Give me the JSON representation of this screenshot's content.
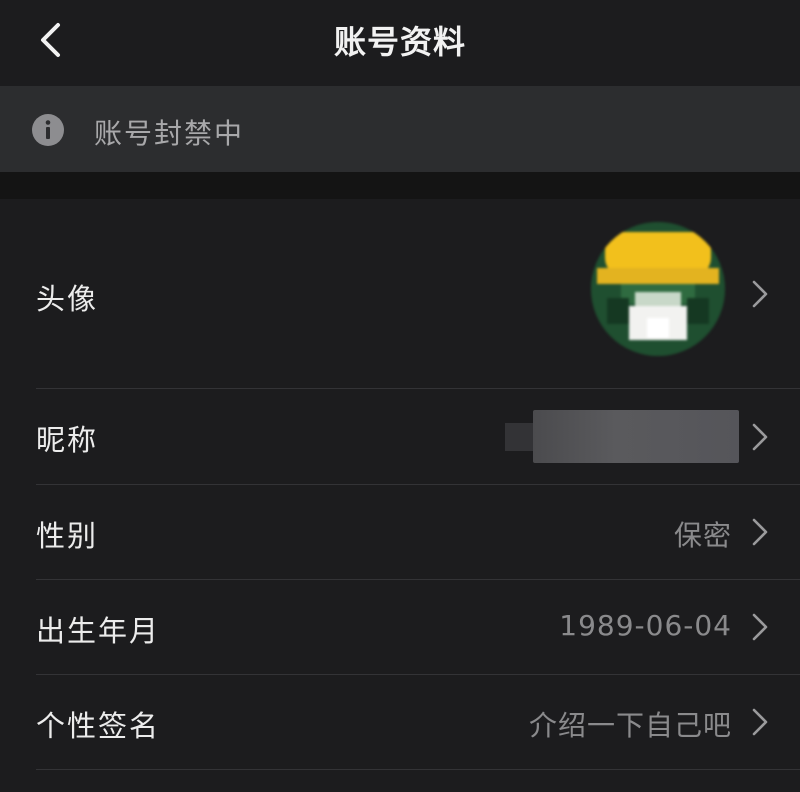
{
  "header": {
    "title": "账号资料"
  },
  "notice": {
    "text": "账号封禁中",
    "icon": "info-icon"
  },
  "rows": [
    {
      "label": "头像",
      "value": "",
      "kind": "avatar"
    },
    {
      "label": "昵称",
      "value": "",
      "kind": "nickname"
    },
    {
      "label": "性别",
      "value": "保密",
      "kind": "text"
    },
    {
      "label": "出生年月",
      "value": "1989-06-04",
      "kind": "text"
    },
    {
      "label": "个性签名",
      "value": "介绍一下自己吧",
      "kind": "text"
    }
  ],
  "colors": {
    "background": "#1c1c1e",
    "notice_bg": "#2c2d2f",
    "text_primary": "#ececec",
    "text_secondary": "#8a8a8c"
  }
}
